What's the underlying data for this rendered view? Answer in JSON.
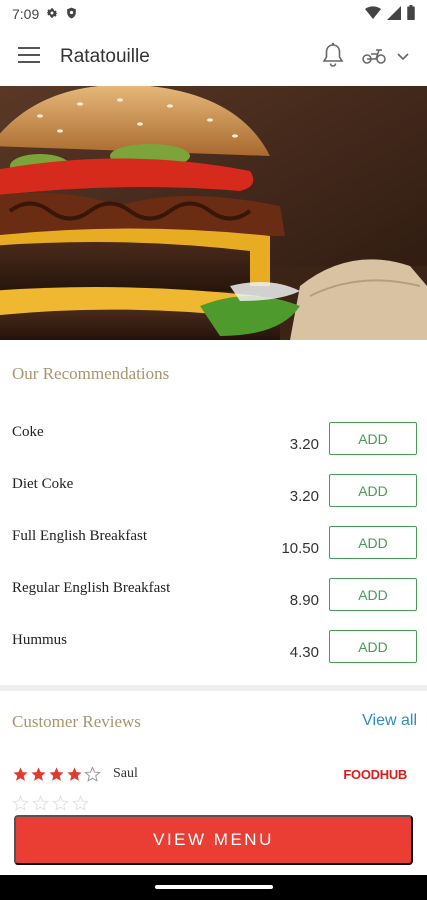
{
  "status_bar": {
    "time": "7:09"
  },
  "app_bar": {
    "title": "Ratatouille"
  },
  "recommendations": {
    "title": "Our Recommendations",
    "add_label": "ADD",
    "items": [
      {
        "name": "Coke",
        "price": "3.20"
      },
      {
        "name": "Diet Coke",
        "price": "3.20"
      },
      {
        "name": "Full English Breakfast",
        "price": "10.50"
      },
      {
        "name": "Regular English Breakfast",
        "price": "8.90"
      },
      {
        "name": "Hummus",
        "price": "4.30"
      }
    ]
  },
  "reviews": {
    "title": "Customer Reviews",
    "view_all": "View all",
    "first": {
      "rating": 4,
      "max": 5,
      "reviewer": "Saul",
      "source": "FOODHUB"
    }
  },
  "footer": {
    "view_menu_label": "VIEW MENU"
  },
  "colors": {
    "accent_red": "#ea3d33",
    "add_green": "#4a9a58",
    "section_gold": "#a8956e",
    "link_blue": "#2f8bc0"
  }
}
